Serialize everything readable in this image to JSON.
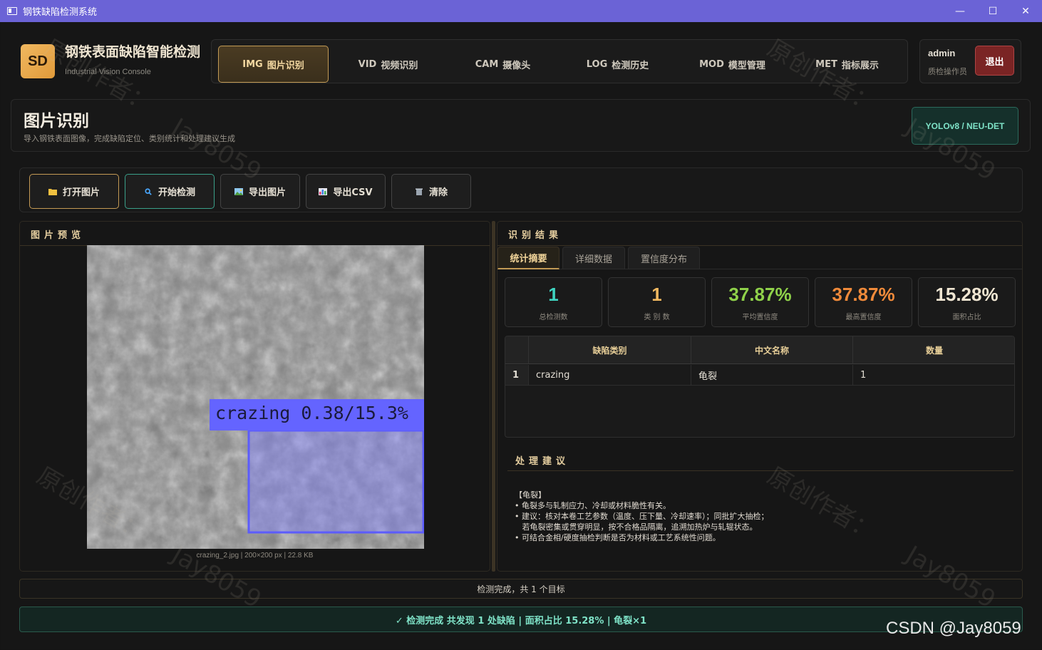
{
  "window": {
    "title": "钢铁缺陷检测系统",
    "controls": [
      "—",
      "☐",
      "✕"
    ]
  },
  "brand": {
    "logo": "SD",
    "title": "钢铁表面缺陷智能检测",
    "subtitle": "Industrial Vision Console"
  },
  "nav": [
    {
      "code": "IMG",
      "label": "图片识别",
      "active": true
    },
    {
      "code": "VID",
      "label": "视频识别",
      "active": false
    },
    {
      "code": "CAM",
      "label": "摄像头",
      "active": false
    },
    {
      "code": "LOG",
      "label": "检测历史",
      "active": false
    },
    {
      "code": "MOD",
      "label": "模型管理",
      "active": false
    },
    {
      "code": "MET",
      "label": "指标展示",
      "active": false
    }
  ],
  "user": {
    "name": "admin",
    "role": "质检操作员",
    "logout": "退出"
  },
  "page": {
    "title": "图片识别",
    "subtitle": "导入钢铁表面图像，完成缺陷定位、类别统计和处理建议生成",
    "model_badge": "YOLOv8 / NEU-DET"
  },
  "toolbar": {
    "open": "打开图片",
    "start": "开始检测",
    "export_img": "导出图片",
    "export_csv": "导出CSV",
    "clear": "清除"
  },
  "preview": {
    "title": "图片预览",
    "detection_label": "crazing 0.38/15.3%",
    "info": "crazing_2.jpg  |  200×200 px  |  22.8 KB"
  },
  "results": {
    "title": "识别结果",
    "tabs": [
      "统计摘要",
      "详细数据",
      "置信度分布"
    ],
    "stats": [
      {
        "value": "1",
        "label": "总检测数",
        "color": "#3fd3c0"
      },
      {
        "value": "1",
        "label": "类 别 数",
        "color": "#f0b860"
      },
      {
        "value": "37.87%",
        "label": "平均置信度",
        "color": "#8fd14a"
      },
      {
        "value": "37.87%",
        "label": "最高置信度",
        "color": "#f08a3a"
      },
      {
        "value": "15.28%",
        "label": "面积占比",
        "color": "#f0e6d2"
      }
    ],
    "table": {
      "headers": [
        "缺陷类别",
        "中文名称",
        "数量"
      ],
      "rows": [
        {
          "index": "1",
          "class": "crazing",
          "cn": "龟裂",
          "count": "1"
        }
      ]
    },
    "advice_title": "处理建议",
    "advice": [
      "【龟裂】",
      "• 龟裂多与轧制应力、冷却或材料脆性有关。",
      "• 建议：核对本卷工艺参数（温度、压下量、冷却速率）；同批扩大抽检；",
      "   若龟裂密集或贯穿明显，按不合格品隔离，追溯加热炉与轧辊状态。",
      "• 可结合金相/硬度抽检判断是否为材料或工艺系统性问题。"
    ]
  },
  "status": {
    "line1": "检测完成，共 1 个目标",
    "line2": "✓ 检测完成  共发现 1 处缺陷  |  面积占比 15.28%  |  龟裂×1"
  },
  "watermark": {
    "text1": "原创作者：",
    "text2": "Jay8059"
  },
  "corner": "CSDN @Jay8059"
}
